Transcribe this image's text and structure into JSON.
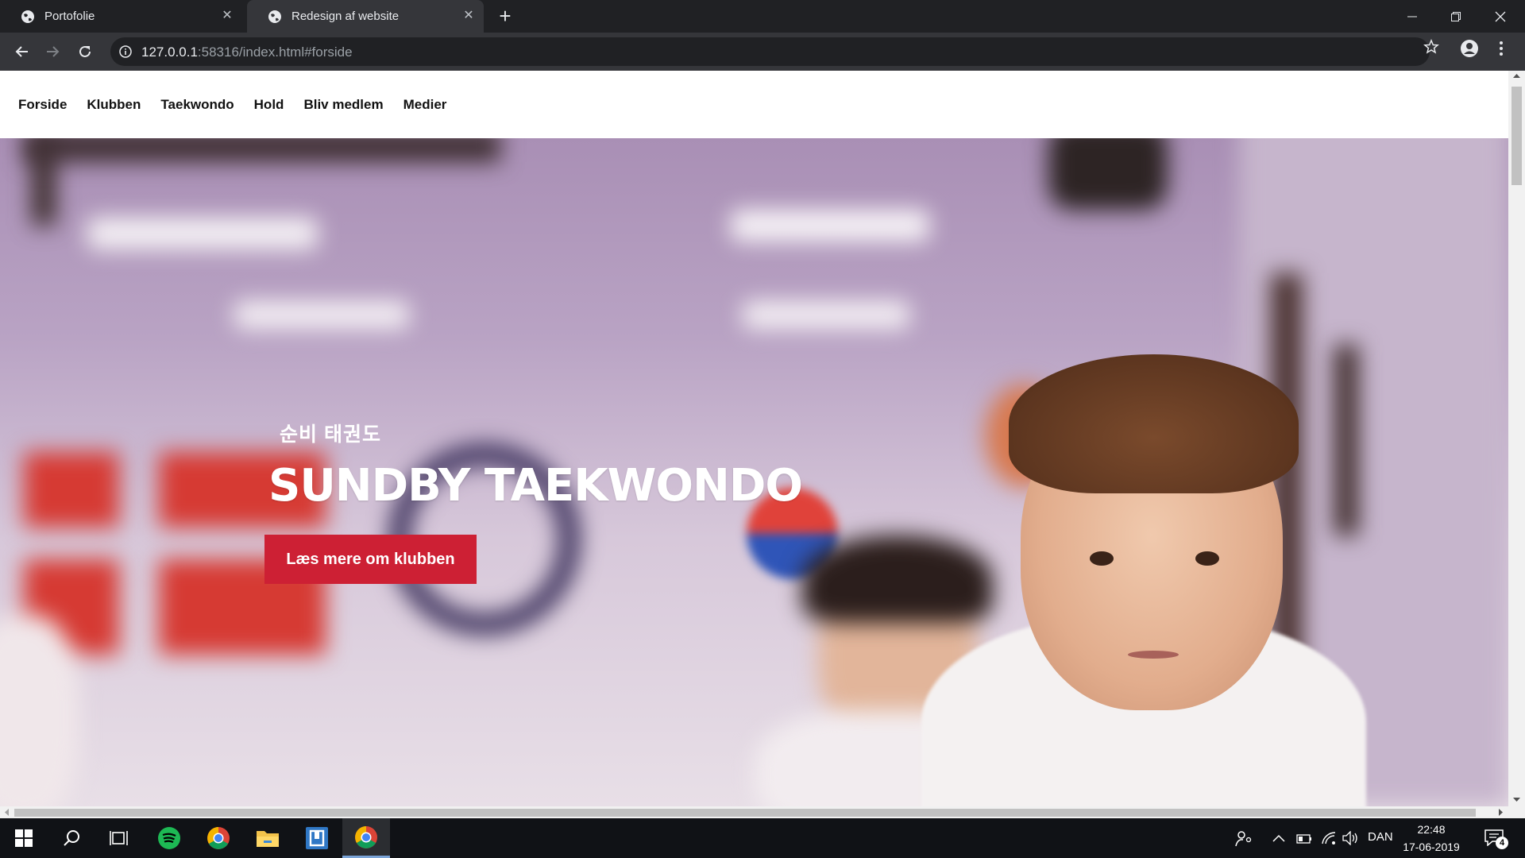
{
  "browser": {
    "tabs": [
      {
        "title": "Portofolie",
        "active": false
      },
      {
        "title": "Redesign af website",
        "active": true
      }
    ],
    "new_tab_symbol": "+",
    "close_symbol": "✕",
    "url_host": "127.0.0.1",
    "url_rest": ":58316/index.html#forside",
    "icons": [
      "globe-icon",
      "back-icon",
      "forward-icon",
      "reload-icon",
      "info-icon",
      "star-icon",
      "account-icon",
      "menu-icon",
      "minimize-icon",
      "restore-icon",
      "close-icon"
    ]
  },
  "site": {
    "nav": [
      "Forside",
      "Klubben",
      "Taekwondo",
      "Hold",
      "Bliv medlem",
      "Medier"
    ],
    "hero": {
      "subtitle": "순비 태권도",
      "title": "SUNDBY TAEKWONDO",
      "button": "Læs mere om klubben"
    },
    "colors": {
      "accent": "#cd2034",
      "text": "#111111"
    }
  },
  "taskbar": {
    "apps": [
      "windows-start-icon",
      "search-icon",
      "task-view-icon",
      "spotify-icon",
      "chrome-icon",
      "file-explorer-icon",
      "app-icon",
      "chrome-active-icon"
    ],
    "language": "DAN",
    "time": "22:48",
    "date": "17-06-2019",
    "notification_count": "4"
  }
}
